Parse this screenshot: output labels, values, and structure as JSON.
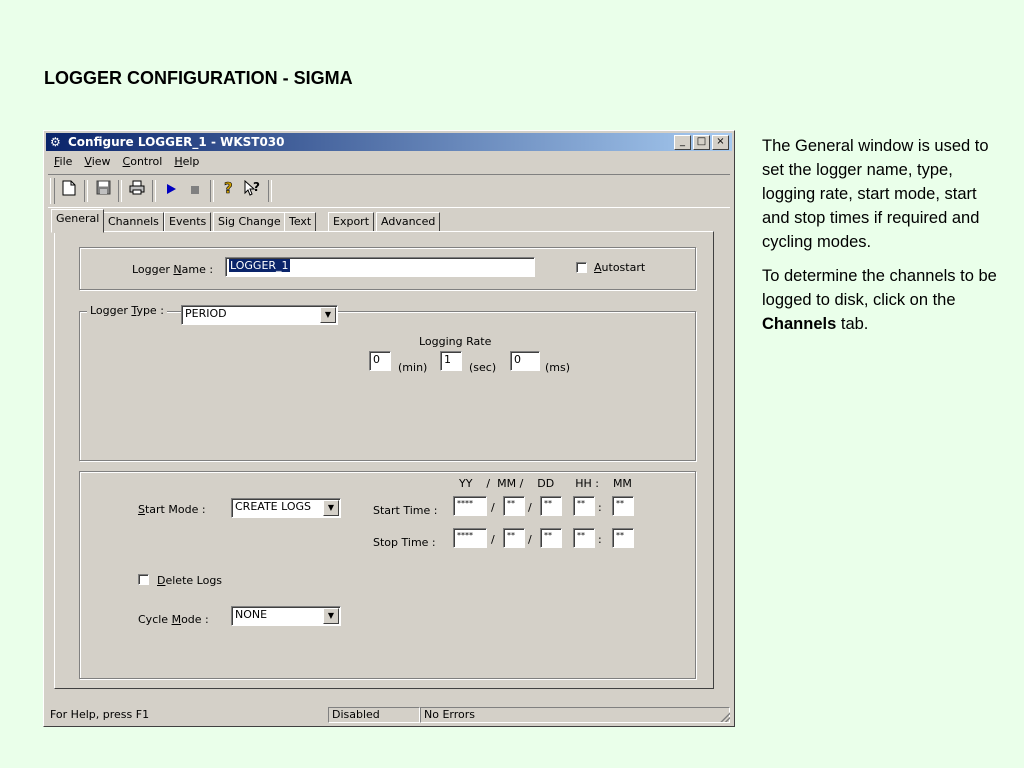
{
  "slide": {
    "title": "LOGGER CONFIGURATION - SIGMA",
    "description_p1": "The General window is used to set the logger name, type, logging rate, start mode, start and stop times if required and cycling modes.",
    "description_p2_a": "To determine the channels to be logged to disk, click on the ",
    "description_p2_bold": "Channels",
    "description_p2_b": " tab."
  },
  "window": {
    "title": "Configure LOGGER_1 - WKST030",
    "buttons": {
      "minimize": "_",
      "maximize": "□",
      "close": "×"
    }
  },
  "menubar": {
    "file": {
      "key": "F",
      "rest": "ile"
    },
    "view": {
      "key": "V",
      "rest": "iew"
    },
    "control": {
      "key": "C",
      "rest": "ontrol"
    },
    "help": {
      "key": "H",
      "rest": "elp"
    }
  },
  "toolbar": {
    "icons": [
      "new-document-icon",
      "save-icon",
      "print-icon",
      "play-icon",
      "stop-icon",
      "help-icon",
      "context-help-icon"
    ]
  },
  "tabs": [
    {
      "label": "General",
      "active": true
    },
    {
      "label": "Channels"
    },
    {
      "label": "Events"
    },
    {
      "label": "Sig Change"
    },
    {
      "label": "Text"
    },
    {
      "label": "Export"
    },
    {
      "label": "Advanced"
    }
  ],
  "general": {
    "logger_name": {
      "label_pre": "Logger ",
      "label_key": "N",
      "label_post": "ame :",
      "value": "LOGGER_1"
    },
    "autostart": {
      "key": "A",
      "rest": "utostart",
      "checked": false
    },
    "logger_type": {
      "label_pre": "Logger ",
      "label_key": "T",
      "label_post": "ype :",
      "value": "PERIOD"
    },
    "logging_rate": {
      "label": "Logging Rate",
      "min": "0",
      "min_unit": "(min)",
      "sec": "1",
      "sec_unit": "(sec)",
      "ms": "0",
      "ms_unit": "(ms)"
    },
    "start_mode": {
      "label_key": "S",
      "label_rest": "tart Mode :",
      "value": "CREATE LOGS"
    },
    "date_header": "YY    /  MM /    DD      HH :    MM",
    "start_time": {
      "label": "Start Time :",
      "yy": "****",
      "mm": "**",
      "dd": "**",
      "hh": "**",
      "min": "**"
    },
    "stop_time": {
      "label": "Stop Time :",
      "yy": "****",
      "mm": "**",
      "dd": "**",
      "hh": "**",
      "min": "**"
    },
    "delete_logs": {
      "key": "D",
      "rest": "elete Logs",
      "checked": false
    },
    "cycle_mode": {
      "label_pre": "Cycle ",
      "label_key": "M",
      "label_post": "ode :",
      "value": "NONE"
    },
    "sep_slash": "/",
    "sep_colon": ":"
  },
  "status": {
    "help": "For Help, press F1",
    "state": "Disabled",
    "errors": "No Errors"
  }
}
